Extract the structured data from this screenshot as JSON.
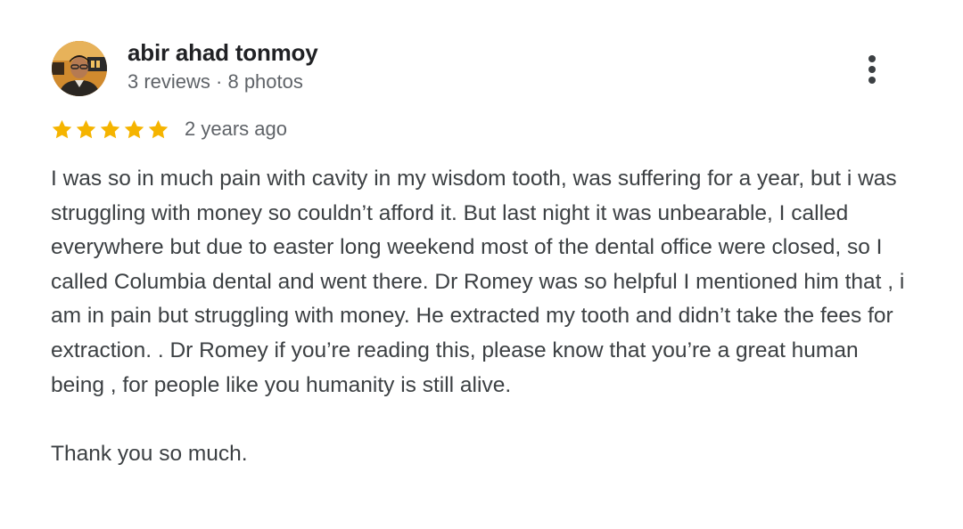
{
  "reviewer": {
    "name": "abir ahad tonmoy",
    "meta": "3 reviews · 8 photos",
    "avatar_icon": "profile-photo"
  },
  "menu": {
    "icon": "more-vert-icon"
  },
  "review": {
    "rating": 5,
    "rating_max": 5,
    "star_color": "#f5b400",
    "date": "2 years ago",
    "body": "I was so in much pain with cavity in my wisdom tooth, was suffering for a year, but i was struggling with money so couldn’t afford it. But last night it was unbearable, I called everywhere but due to easter long weekend most of the dental office were closed, so I called Columbia dental and went there. Dr Romey was so helpful I mentioned him that , i am in pain but struggling with money. He extracted my tooth and didn’t take the fees for extraction. . Dr Romey if you’re reading this, please know that you’re a great human being , for people like you humanity is still alive.",
    "closing": "Thank you so much."
  }
}
